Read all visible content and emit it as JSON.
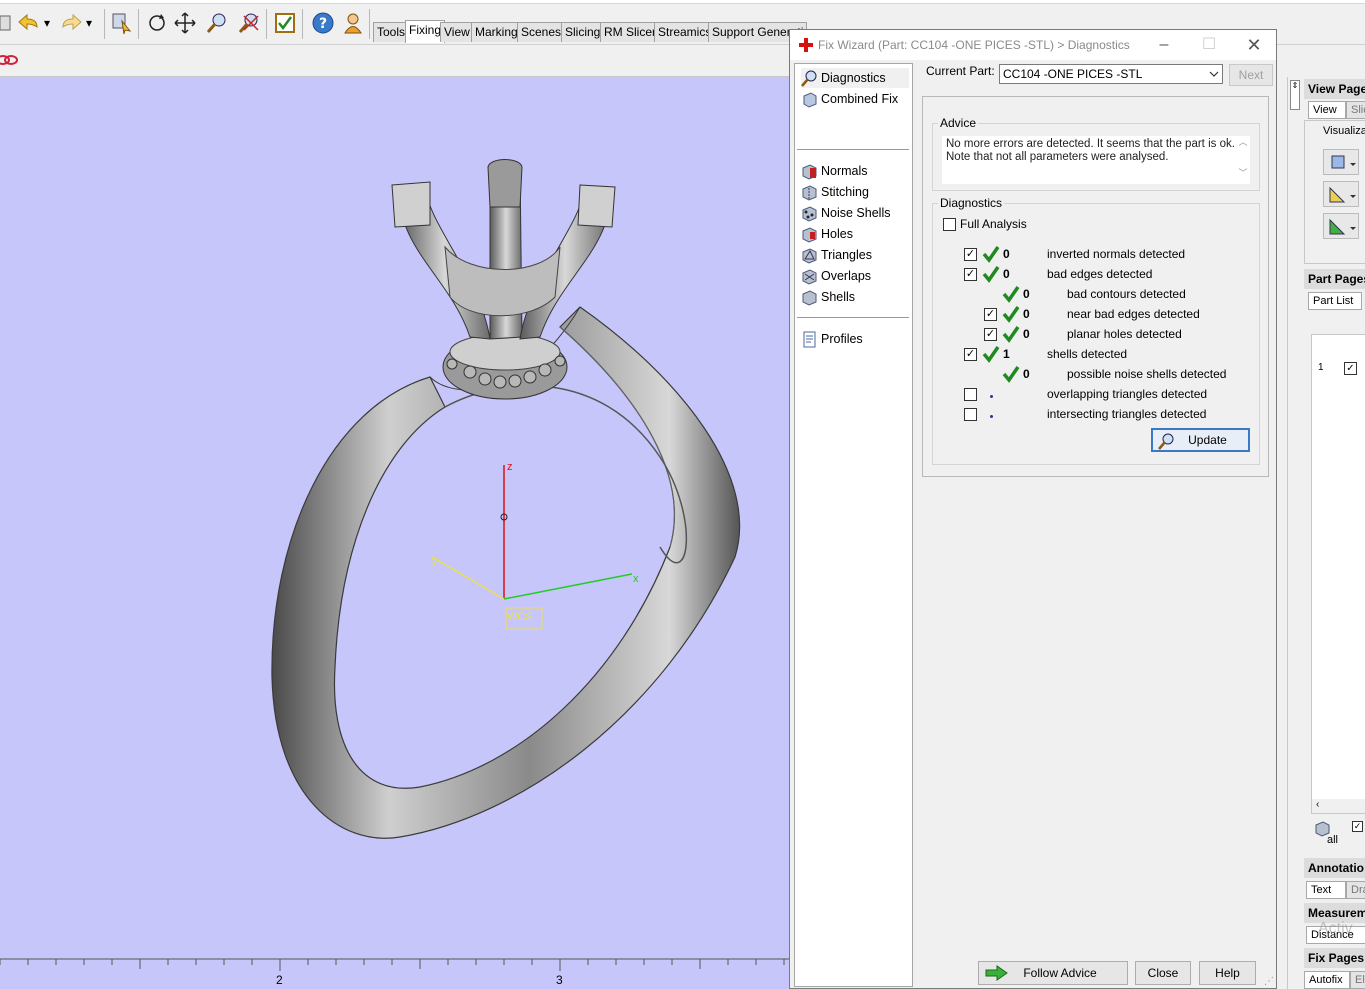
{
  "toolbar": {
    "tabs": [
      "Tools",
      "Fixing",
      "View",
      "Marking",
      "Scenes",
      "Slicing",
      "RM Slicer",
      "Streamics",
      "Support Generati"
    ],
    "active_tab": "Fixing",
    "icons": [
      "undo-icon",
      "redo-icon",
      "part-select-icon",
      "rotate-icon",
      "pan-icon",
      "zoom-icon",
      "zoom-extent-icon",
      "fix-wizard-icon",
      "help-icon",
      "wizard-user-icon"
    ]
  },
  "viewport": {
    "background_color": "#c6c6fa",
    "axes": {
      "z_label": "z",
      "y_label": "y",
      "x_label": "x",
      "wcs_label": "WCS"
    },
    "ruler_labels": [
      "2",
      "3"
    ]
  },
  "dialog": {
    "title": "Fix Wizard (Part: CC104 -ONE PICES -STL) > Diagnostics",
    "nav": {
      "top": [
        {
          "label": "Diagnostics",
          "icon": "diagnostics-icon",
          "selected": true
        },
        {
          "label": "Combined Fix",
          "icon": "combined-fix-icon"
        }
      ],
      "fixes": [
        {
          "label": "Normals",
          "icon": "normals-icon"
        },
        {
          "label": "Stitching",
          "icon": "stitching-icon"
        },
        {
          "label": "Noise Shells",
          "icon": "noise-shells-icon"
        },
        {
          "label": "Holes",
          "icon": "holes-icon"
        },
        {
          "label": "Triangles",
          "icon": "triangles-icon"
        },
        {
          "label": "Overlaps",
          "icon": "overlaps-icon"
        },
        {
          "label": "Shells",
          "icon": "shells-icon"
        }
      ],
      "bottom": [
        {
          "label": "Profiles",
          "icon": "profiles-icon"
        }
      ]
    },
    "current_part_label": "Current Part:",
    "current_part_value": "CC104 -ONE PICES -STL",
    "next_label": "Next",
    "advice": {
      "title": "Advice",
      "line1": "No more errors are detected. It seems that the part is ok.",
      "line2": "Note that not all parameters were analysed."
    },
    "diagnostics": {
      "title": "Diagnostics",
      "full_analysis_label": "Full Analysis",
      "full_analysis_checked": false,
      "rows": [
        {
          "checkbox": true,
          "checked": true,
          "status": "ok",
          "count": "0",
          "label": "inverted normals detected",
          "indent": 0
        },
        {
          "checkbox": true,
          "checked": true,
          "status": "ok",
          "count": "0",
          "label": "bad edges detected",
          "indent": 0
        },
        {
          "checkbox": false,
          "checked": false,
          "status": "ok",
          "count": "0",
          "label": "bad contours detected",
          "indent": 1
        },
        {
          "checkbox": true,
          "checked": true,
          "status": "ok",
          "count": "0",
          "label": "near bad edges detected",
          "indent": 1
        },
        {
          "checkbox": true,
          "checked": true,
          "status": "ok",
          "count": "0",
          "label": "planar holes detected",
          "indent": 1
        },
        {
          "checkbox": true,
          "checked": true,
          "status": "ok",
          "count": "1",
          "label": "shells detected",
          "indent": 0
        },
        {
          "checkbox": false,
          "checked": false,
          "status": "ok",
          "count": "0",
          "label": "possible noise shells detected",
          "indent": 1
        },
        {
          "checkbox": true,
          "checked": false,
          "status": "pending",
          "count": "",
          "label": "overlapping triangles detected",
          "indent": 0
        },
        {
          "checkbox": true,
          "checked": false,
          "status": "pending",
          "count": "",
          "label": "intersecting triangles detected",
          "indent": 0
        }
      ],
      "update_label": "Update"
    },
    "buttons": {
      "follow_advice": "Follow Advice",
      "close": "Close",
      "help": "Help"
    }
  },
  "right_panel": {
    "view_pages": {
      "title": "View Pages",
      "tab1": "View",
      "tab2": "Slice",
      "group": "Visualizat"
    },
    "part_pages": {
      "title": "Part Pages",
      "tab1": "Part List",
      "row_index": "1",
      "row_checked": true,
      "all_label": "all"
    },
    "annotation": {
      "title": "Annotatio",
      "tab1": "Text",
      "tab2": "Dra"
    },
    "measurement": {
      "title": "Measurem",
      "tab1": "Distance"
    },
    "fix_pages": {
      "title": "Fix Pages",
      "tab1": "Autofix",
      "tab2": "Els"
    },
    "watermark": "Activ"
  },
  "colors": {
    "check_green": "#1f8a1f",
    "axis_x": "#22cc22",
    "axis_y": "#e8e050",
    "axis_z": "#e01010",
    "accent_blue": "#3a78c8"
  }
}
